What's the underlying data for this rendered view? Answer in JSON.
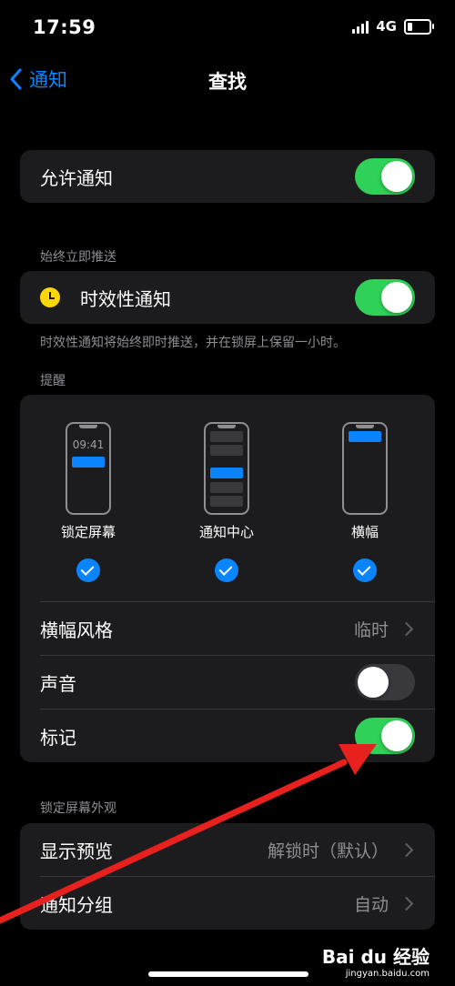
{
  "status_bar": {
    "time": "17:59",
    "network": "4G"
  },
  "nav": {
    "back_label": "通知",
    "title": "查找"
  },
  "allow_notifications": {
    "label": "允许通知",
    "enabled": true
  },
  "immediate": {
    "header": "始终立即推送",
    "label": "时效性通知",
    "enabled": true,
    "footnote": "时效性通知将始终即时推送，并在锁屏上保留一小时。"
  },
  "alerts": {
    "header": "提醒",
    "previews": [
      {
        "label": "锁定屏幕",
        "clock": "09:41",
        "checked": true
      },
      {
        "label": "通知中心",
        "checked": true
      },
      {
        "label": "横幅",
        "checked": true
      }
    ],
    "banner_style": {
      "label": "横幅风格",
      "value": "临时"
    },
    "sounds": {
      "label": "声音",
      "enabled": false
    },
    "badges": {
      "label": "标记",
      "enabled": true
    }
  },
  "lock_screen": {
    "header": "锁定屏幕外观",
    "show_previews": {
      "label": "显示预览",
      "value": "解锁时（默认）"
    },
    "grouping": {
      "label": "通知分组",
      "value": "自动"
    }
  },
  "watermark": {
    "logo": "Bai du 经验",
    "url": "jingyan.baidu.com"
  },
  "colors": {
    "accent": "#0a84ff",
    "toggle_on": "#30d158",
    "arrow": "#e8211f",
    "card": "#1c1c1e"
  }
}
